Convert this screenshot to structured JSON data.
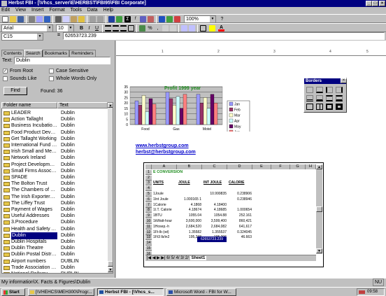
{
  "window": {
    "title": "Herbst FBI - [\\Vhcs_server\\E\\HERBST\\FBI95\\FBI Corporate]",
    "min": "_",
    "max": "□",
    "close": "×"
  },
  "menu": [
    "Edit",
    "View",
    "Insert",
    "Format",
    "Tools",
    "Data",
    "Help"
  ],
  "toolbar": {
    "zoom": "100%",
    "font": "Arial",
    "size": "10",
    "bold": "B",
    "italic": "I",
    "underline": "U"
  },
  "formula_bar": {
    "cell_ref": "C15",
    "eq": "=",
    "value": "62653723.239"
  },
  "search": {
    "tabs": [
      "Contents",
      "Search",
      "Bookmarks",
      "Reminders"
    ],
    "text_label": "Text:",
    "text_value": "Dublin",
    "from_root": "From Root",
    "case_sensitive": "Case Sensitive",
    "sounds_like": "Sounds Like",
    "whole_words": "Whole Words Only",
    "find": "Find",
    "found": "Found: 36",
    "col_folder": "Folder name",
    "col_text": "Text",
    "results": [
      {
        "name": "LEADER",
        "text": "Dublin"
      },
      {
        "name": "Action Tallaght",
        "text": "Dublin"
      },
      {
        "name": "Business Incubation Ce...",
        "text": "Dublin"
      },
      {
        "name": "Food Product Develop...",
        "text": "Dublin"
      },
      {
        "name": "Get Tallaght Working",
        "text": "Dublin"
      },
      {
        "name": "International Fund for I...",
        "text": "Dublin"
      },
      {
        "name": "Irish Small and Medium...",
        "text": "Dublin"
      },
      {
        "name": "Network Ireland",
        "text": "Dublin"
      },
      {
        "name": "Project Development C...",
        "text": "Dublin"
      },
      {
        "name": "Small Firms Association",
        "text": "Dublin"
      },
      {
        "name": "SPADE",
        "text": "Dublin"
      },
      {
        "name": "The Bolton Trust",
        "text": "Dublin"
      },
      {
        "name": "The Chambers of Comm...",
        "text": "Dublin"
      },
      {
        "name": "The Irish Exporters Asso...",
        "text": "Dublin"
      },
      {
        "name": "The Liffey Trust",
        "text": "Dublin"
      },
      {
        "name": "Payment of Wages",
        "text": "Dublin"
      },
      {
        "name": "Useful Addresses",
        "text": "Dublin"
      },
      {
        "name": "3.Procedure",
        "text": "Dublin"
      },
      {
        "name": "Health and Safety Auth...",
        "text": "Dublin"
      },
      {
        "name": "Dublin",
        "text": "Dublin"
      },
      {
        "name": "Dublin Hospitals",
        "text": "Dublin"
      },
      {
        "name": "Dublin Theatre",
        "text": "Dublin"
      },
      {
        "name": "Dublin Postal District Co...",
        "text": "Dublin"
      },
      {
        "name": "Airport numbers",
        "text": "DUBLIN"
      },
      {
        "name": "Trade Association & Uni...",
        "text": "Dublin"
      },
      {
        "name": "National Railway",
        "text": "DUBLIN"
      }
    ],
    "selected_index": 19
  },
  "chart_data": {
    "type": "bar",
    "title": "Profit 1999 year",
    "categories": [
      "Food",
      "Gas",
      "Motel"
    ],
    "ylim": [
      0,
      35
    ],
    "yticks": [
      "35",
      "30",
      "25",
      "20",
      "15",
      "10",
      "5",
      "0"
    ],
    "series": [
      {
        "name": "Jan",
        "color": "#9999ff",
        "values": [
          22,
          30,
          28
        ]
      },
      {
        "name": "Feb",
        "color": "#993366",
        "values": [
          18,
          24,
          20
        ]
      },
      {
        "name": "Mar",
        "color": "#ffffcc",
        "values": [
          27,
          18,
          25
        ]
      },
      {
        "name": "Apr",
        "color": "#ccffff",
        "values": [
          12,
          26,
          15
        ]
      },
      {
        "name": "May",
        "color": "#660066",
        "values": [
          24,
          15,
          28
        ]
      },
      {
        "name": "Jun",
        "color": "#ff8080",
        "values": [
          19,
          28,
          20
        ]
      }
    ]
  },
  "links": [
    "www.herbstgroup.com",
    "herbst@herbstgroup.com"
  ],
  "borders": {
    "title": "Borders",
    "close": "×"
  },
  "sheet": {
    "cols": [
      "A",
      "B",
      "C",
      "D",
      "E",
      "F",
      "G",
      "H"
    ],
    "title": "E CONVERSION",
    "headers": [
      "UNITS",
      "JOULE",
      "INT JOULE",
      "CALORIE"
    ],
    "rows": [
      [
        "1Joule",
        "",
        "10.999835",
        "0.238906"
      ],
      [
        "1Int Joule",
        "1.000165 1",
        "",
        "0.238946"
      ],
      [
        "1Calorie",
        "4.1868",
        "4.18400",
        ""
      ],
      [
        "1I.T. Calorie",
        "4.18674",
        "4.18685",
        "1.000654"
      ],
      [
        "1BTU",
        "1055.04",
        "1054.88",
        "252.161"
      ],
      [
        "1kWatt-hour",
        "3,600,000",
        "3,599,400",
        "860,421"
      ],
      [
        "1Hosep.-h",
        "2,684,520",
        "2,684,082",
        "641,617"
      ],
      [
        "1Ft-lb (wt)",
        "1.35582",
        "1.355537",
        "0.324045"
      ],
      [
        "1Ft3 lb/in2",
        "195,238",
        "195,206",
        "46.663"
      ]
    ],
    "selected_value": "62653723.239",
    "sheet_tabs": "6/ 5/ 4/ 3/ 2/",
    "active_tab": "Sheet1"
  },
  "status": {
    "text": "My information\\X. Facts & Figures\\Dublin",
    "mode": "NU"
  },
  "taskbar": {
    "start": "Start",
    "tasks": [
      "[\\VHEHCS\\MEH300\\Progr...",
      "Herbst FBI - [\\Vhcs_s...",
      "Microsoft Word - FBI for W..."
    ],
    "clock": "09:58"
  }
}
